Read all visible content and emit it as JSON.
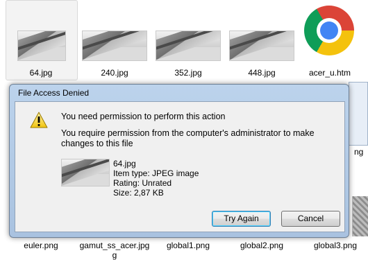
{
  "explorer": {
    "files": [
      {
        "name": "64.jpg"
      },
      {
        "name": "240.jpg"
      },
      {
        "name": "352.jpg"
      },
      {
        "name": "448.jpg"
      },
      {
        "name": "acer_u.htm"
      }
    ],
    "bottom_files": [
      {
        "name": "euler.png"
      },
      {
        "name": "gamut_ss_acer.jpg"
      },
      {
        "name": "global1.png"
      },
      {
        "name": "global2.png"
      },
      {
        "name": "global3.png"
      }
    ],
    "bottom_file_wrap": "g",
    "side_partial_label": "ng"
  },
  "dialog": {
    "title": "File Access Denied",
    "icon": "warning-icon",
    "headline": "You need permission to perform this action",
    "description": "You require permission from the computer's administrator to make changes to this file",
    "file": {
      "name": "64.jpg",
      "item_type": "Item type: JPEG image",
      "rating": "Rating: Unrated",
      "size": "Size: 2,87 KB"
    },
    "buttons": {
      "try_again": "Try Again",
      "cancel": "Cancel"
    },
    "colors": {
      "frame": "#a9c2e0",
      "client": "#f0f0f0",
      "default_button_border": "#3c7fb1"
    }
  }
}
